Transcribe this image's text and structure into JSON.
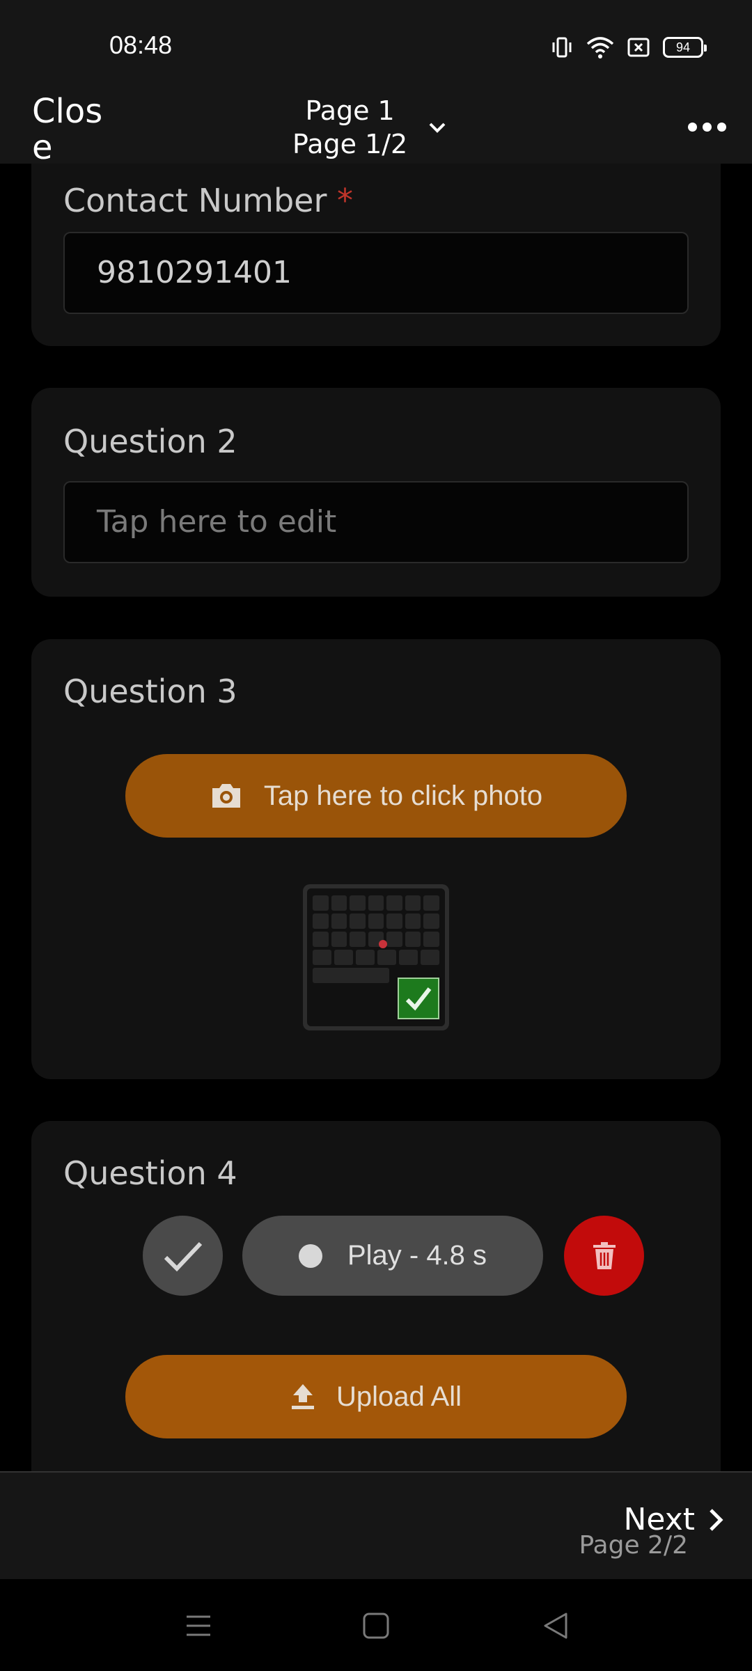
{
  "status_bar": {
    "time": "08:48",
    "battery": "94",
    "icons": [
      "vibrate-icon",
      "wifi-icon",
      "sim-error-icon",
      "battery-icon"
    ]
  },
  "app_bar": {
    "close_label": "Close",
    "page_title": "Page 1",
    "page_subtitle": "Page 1/2",
    "dropdown_icon": "chevron-down-icon",
    "menu_icon": "more-horizontal-icon"
  },
  "form": {
    "contact": {
      "label": "Contact Number",
      "required_mark": "*",
      "value": "9810291401"
    },
    "question2": {
      "label": "Question 2",
      "placeholder": "Tap here to edit"
    },
    "question3": {
      "label": "Question 3",
      "photo_button_label": "Tap here to click photo",
      "photo_icon": "camera-icon",
      "thumbnail_status_icon": "checkmark-icon"
    },
    "question4": {
      "label": "Question 4",
      "play_label": "Play - 4.8 s",
      "done_icon": "checkmark-icon",
      "delete_icon": "trash-icon"
    },
    "upload_all_label": "Upload All",
    "upload_icon": "upload-icon"
  },
  "bottom_nav": {
    "next_label": "Next",
    "next_sub": "Page 2/2",
    "next_icon": "chevron-right-icon"
  },
  "colors": {
    "accent_orange": "#9a5409",
    "delete_red": "#c20b0b",
    "required_red": "#c0352b",
    "card_bg": "#121212"
  }
}
